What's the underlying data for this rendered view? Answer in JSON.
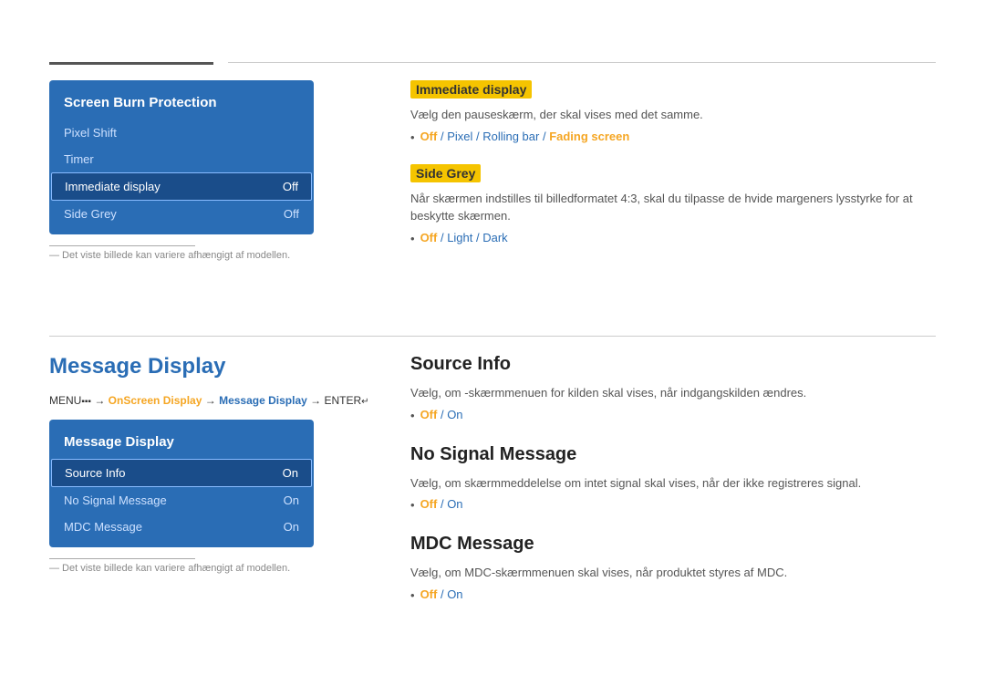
{
  "topDivider": {},
  "screenBurnPanel": {
    "title": "Screen Burn Protection",
    "items": [
      {
        "label": "Pixel Shift",
        "value": "",
        "active": false
      },
      {
        "label": "Timer",
        "value": "",
        "active": false
      },
      {
        "label": "Immediate display",
        "value": "Off",
        "active": true
      },
      {
        "label": "Side Grey",
        "value": "Off",
        "active": false
      }
    ],
    "footnote": "― Det viste billede kan variere afhængigt af modellen."
  },
  "immediateDisplaySection": {
    "label": "Immediate display",
    "desc": "Vælg den pauseskærm, der skal vises med det samme.",
    "options": "Off / Pixel / Rolling bar / Fading screen"
  },
  "sideGreySection": {
    "label": "Side Grey",
    "desc": "Når skærmen indstilles til billedformatet 4:3, skal du tilpasse de hvide margeners lysstyrke for at beskytte skærmen.",
    "options": "Off / Light / Dark"
  },
  "messageDisplayTitle": "Message Display",
  "menuPath": {
    "prefix": "MENU",
    "menuSymbol": "⁻⁻",
    "arrow1": " → ",
    "link1": "OnScreen Display",
    "arrow2": " → ",
    "link2": "Message Display",
    "arrow3": " → ",
    "enterSymbol": "ENTER"
  },
  "messageDisplayPanel": {
    "title": "Message Display",
    "items": [
      {
        "label": "Source Info",
        "value": "On",
        "active": true
      },
      {
        "label": "No Signal Message",
        "value": "On",
        "active": false
      },
      {
        "label": "MDC Message",
        "value": "On",
        "active": false
      }
    ],
    "footnote": "― Det viste billede kan variere afhængigt af modellen."
  },
  "sourceInfoSection": {
    "heading": "Source Info",
    "desc": "Vælg, om -skærmmenuen for kilden skal vises, når indgangskilden ændres.",
    "options": "Off / On"
  },
  "noSignalSection": {
    "heading": "No Signal Message",
    "desc": "Vælg, om skærmmeddelelse om intet signal skal vises, når der ikke registreres signal.",
    "options": "Off / On"
  },
  "mdcMessageSection": {
    "heading": "MDC Message",
    "desc": "Vælg, om MDC-skærmmenuen skal vises, når produktet styres af MDC.",
    "options": "Off / On"
  }
}
